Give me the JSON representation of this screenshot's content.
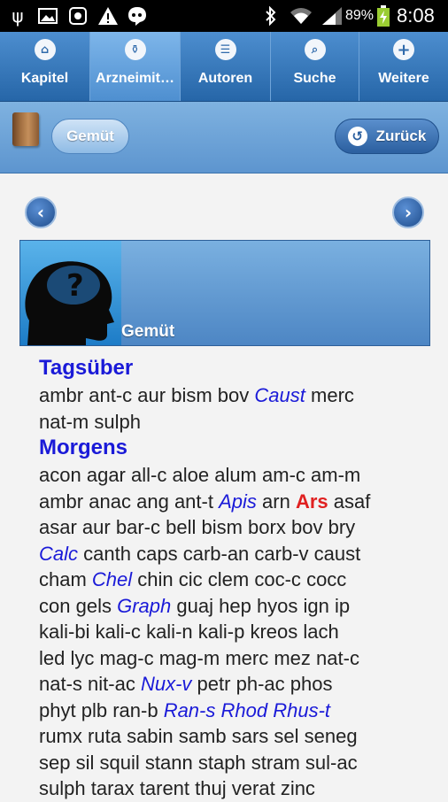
{
  "status_bar": {
    "icons": [
      "usb-icon",
      "image-icon",
      "app-icon",
      "warning-icon",
      "chat-icon",
      "bluetooth-icon",
      "wifi-icon",
      "signal-icon",
      "battery-icon"
    ],
    "battery": "89%",
    "time": "8:08"
  },
  "tabs": [
    {
      "label": "Kapitel",
      "icon": "home-icon",
      "active": false
    },
    {
      "label": "Arzneimit…",
      "icon": "remedy-icon",
      "active": true
    },
    {
      "label": "Autoren",
      "icon": "authors-icon",
      "active": false
    },
    {
      "label": "Suche",
      "icon": "search-icon",
      "active": false
    },
    {
      "label": "Weitere",
      "icon": "plus-icon",
      "active": false
    }
  ],
  "subbar": {
    "chapter_button": "Gemüt",
    "back_button": "Zurück"
  },
  "banner": {
    "title": "Gemüt"
  },
  "colors": {
    "accent": "#2f6fb5",
    "rubric_blue": "#1a1ad8",
    "remedy_red": "#e02020"
  },
  "sections": [
    {
      "title": "Tagsüber",
      "lines": [
        [
          {
            "t": "ambr"
          },
          {
            "t": "ant-c"
          },
          {
            "t": "aur"
          },
          {
            "t": "bism"
          },
          {
            "t": "bov"
          },
          {
            "t": "Caust",
            "s": "italic"
          },
          {
            "t": "merc"
          }
        ],
        [
          {
            "t": "nat-m"
          },
          {
            "t": "sulph"
          }
        ]
      ]
    },
    {
      "title": "Morgens",
      "lines": [
        [
          {
            "t": "acon"
          },
          {
            "t": "agar"
          },
          {
            "t": "all-c"
          },
          {
            "t": "aloe"
          },
          {
            "t": "alum"
          },
          {
            "t": "am-c"
          },
          {
            "t": "am-m"
          }
        ],
        [
          {
            "t": "ambr"
          },
          {
            "t": "anac"
          },
          {
            "t": "ang"
          },
          {
            "t": "ant-t"
          },
          {
            "t": "Apis",
            "s": "italic"
          },
          {
            "t": "arn"
          },
          {
            "t": "Ars",
            "s": "red"
          },
          {
            "t": "asaf"
          }
        ],
        [
          {
            "t": "asar"
          },
          {
            "t": "aur"
          },
          {
            "t": "bar-c"
          },
          {
            "t": "bell"
          },
          {
            "t": "bism"
          },
          {
            "t": "borx"
          },
          {
            "t": "bov"
          },
          {
            "t": "bry"
          }
        ],
        [
          {
            "t": "Calc",
            "s": "italic"
          },
          {
            "t": "canth"
          },
          {
            "t": "caps"
          },
          {
            "t": "carb-an"
          },
          {
            "t": "carb-v"
          },
          {
            "t": "caust"
          }
        ],
        [
          {
            "t": "cham"
          },
          {
            "t": "Chel",
            "s": "italic"
          },
          {
            "t": "chin"
          },
          {
            "t": "cic"
          },
          {
            "t": "clem"
          },
          {
            "t": "coc-c"
          },
          {
            "t": "cocc"
          }
        ],
        [
          {
            "t": "con"
          },
          {
            "t": "gels"
          },
          {
            "t": "Graph",
            "s": "italic"
          },
          {
            "t": "guaj"
          },
          {
            "t": "hep"
          },
          {
            "t": "hyos"
          },
          {
            "t": "ign"
          },
          {
            "t": "ip"
          }
        ],
        [
          {
            "t": "kali-bi"
          },
          {
            "t": "kali-c"
          },
          {
            "t": "kali-n"
          },
          {
            "t": "kali-p"
          },
          {
            "t": "kreos"
          },
          {
            "t": "lach"
          }
        ],
        [
          {
            "t": "led"
          },
          {
            "t": "lyc"
          },
          {
            "t": "mag-c"
          },
          {
            "t": "mag-m"
          },
          {
            "t": "merc"
          },
          {
            "t": "mez"
          },
          {
            "t": "nat-c"
          }
        ],
        [
          {
            "t": "nat-s"
          },
          {
            "t": "nit-ac"
          },
          {
            "t": "Nux-v",
            "s": "italic"
          },
          {
            "t": "petr"
          },
          {
            "t": "ph-ac"
          },
          {
            "t": "phos"
          }
        ],
        [
          {
            "t": "phyt"
          },
          {
            "t": "plb"
          },
          {
            "t": "ran-b"
          },
          {
            "t": "Ran-s",
            "s": "italic"
          },
          {
            "t": "Rhod",
            "s": "italic"
          },
          {
            "t": "Rhus-t",
            "s": "italic"
          }
        ],
        [
          {
            "t": "rumx"
          },
          {
            "t": "ruta"
          },
          {
            "t": "sabin"
          },
          {
            "t": "samb"
          },
          {
            "t": "sars"
          },
          {
            "t": "sel"
          },
          {
            "t": "seneg"
          }
        ],
        [
          {
            "t": "sep"
          },
          {
            "t": "sil"
          },
          {
            "t": "squil"
          },
          {
            "t": "stann"
          },
          {
            "t": "staph"
          },
          {
            "t": "stram"
          },
          {
            "t": "sul-ac"
          }
        ],
        [
          {
            "t": "sulph"
          },
          {
            "t": "tarax"
          },
          {
            "t": "tarent"
          },
          {
            "t": "thuj"
          },
          {
            "t": "verat"
          },
          {
            "t": "zinc"
          }
        ]
      ]
    }
  ]
}
